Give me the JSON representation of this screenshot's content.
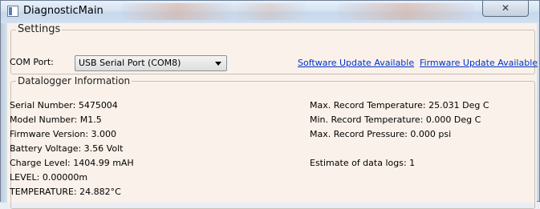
{
  "window": {
    "title": "DiagnosticMain",
    "close_glyph": "✕"
  },
  "settings": {
    "caption": "Settings",
    "com_port_label": "COM Port:",
    "com_port_value": "USB Serial Port (COM8)",
    "software_update_link": "Software Update Available",
    "firmware_update_link": "Firmware Update Available"
  },
  "datalogger": {
    "caption": "Datalogger Information",
    "left_fields": [
      "Serial Number: 5475004",
      "Model Number: M1.5",
      "Firmware Version: 3.000",
      "Battery Voltage: 3.56 Volt",
      "Charge Level: 1404.99 mAH",
      "LEVEL: 0.00000m",
      "TEMPERATURE: 24.882°C"
    ],
    "right_fields": [
      "Max. Record Temperature: 25.031 Deg C",
      "Min. Record Temperature: 0.000 Deg C",
      "Max. Record Pressure: 0.000 psi",
      "Estimate of data logs: 1"
    ]
  },
  "colors": {
    "link": "#0033cc",
    "client_background": "#faf1ea"
  }
}
